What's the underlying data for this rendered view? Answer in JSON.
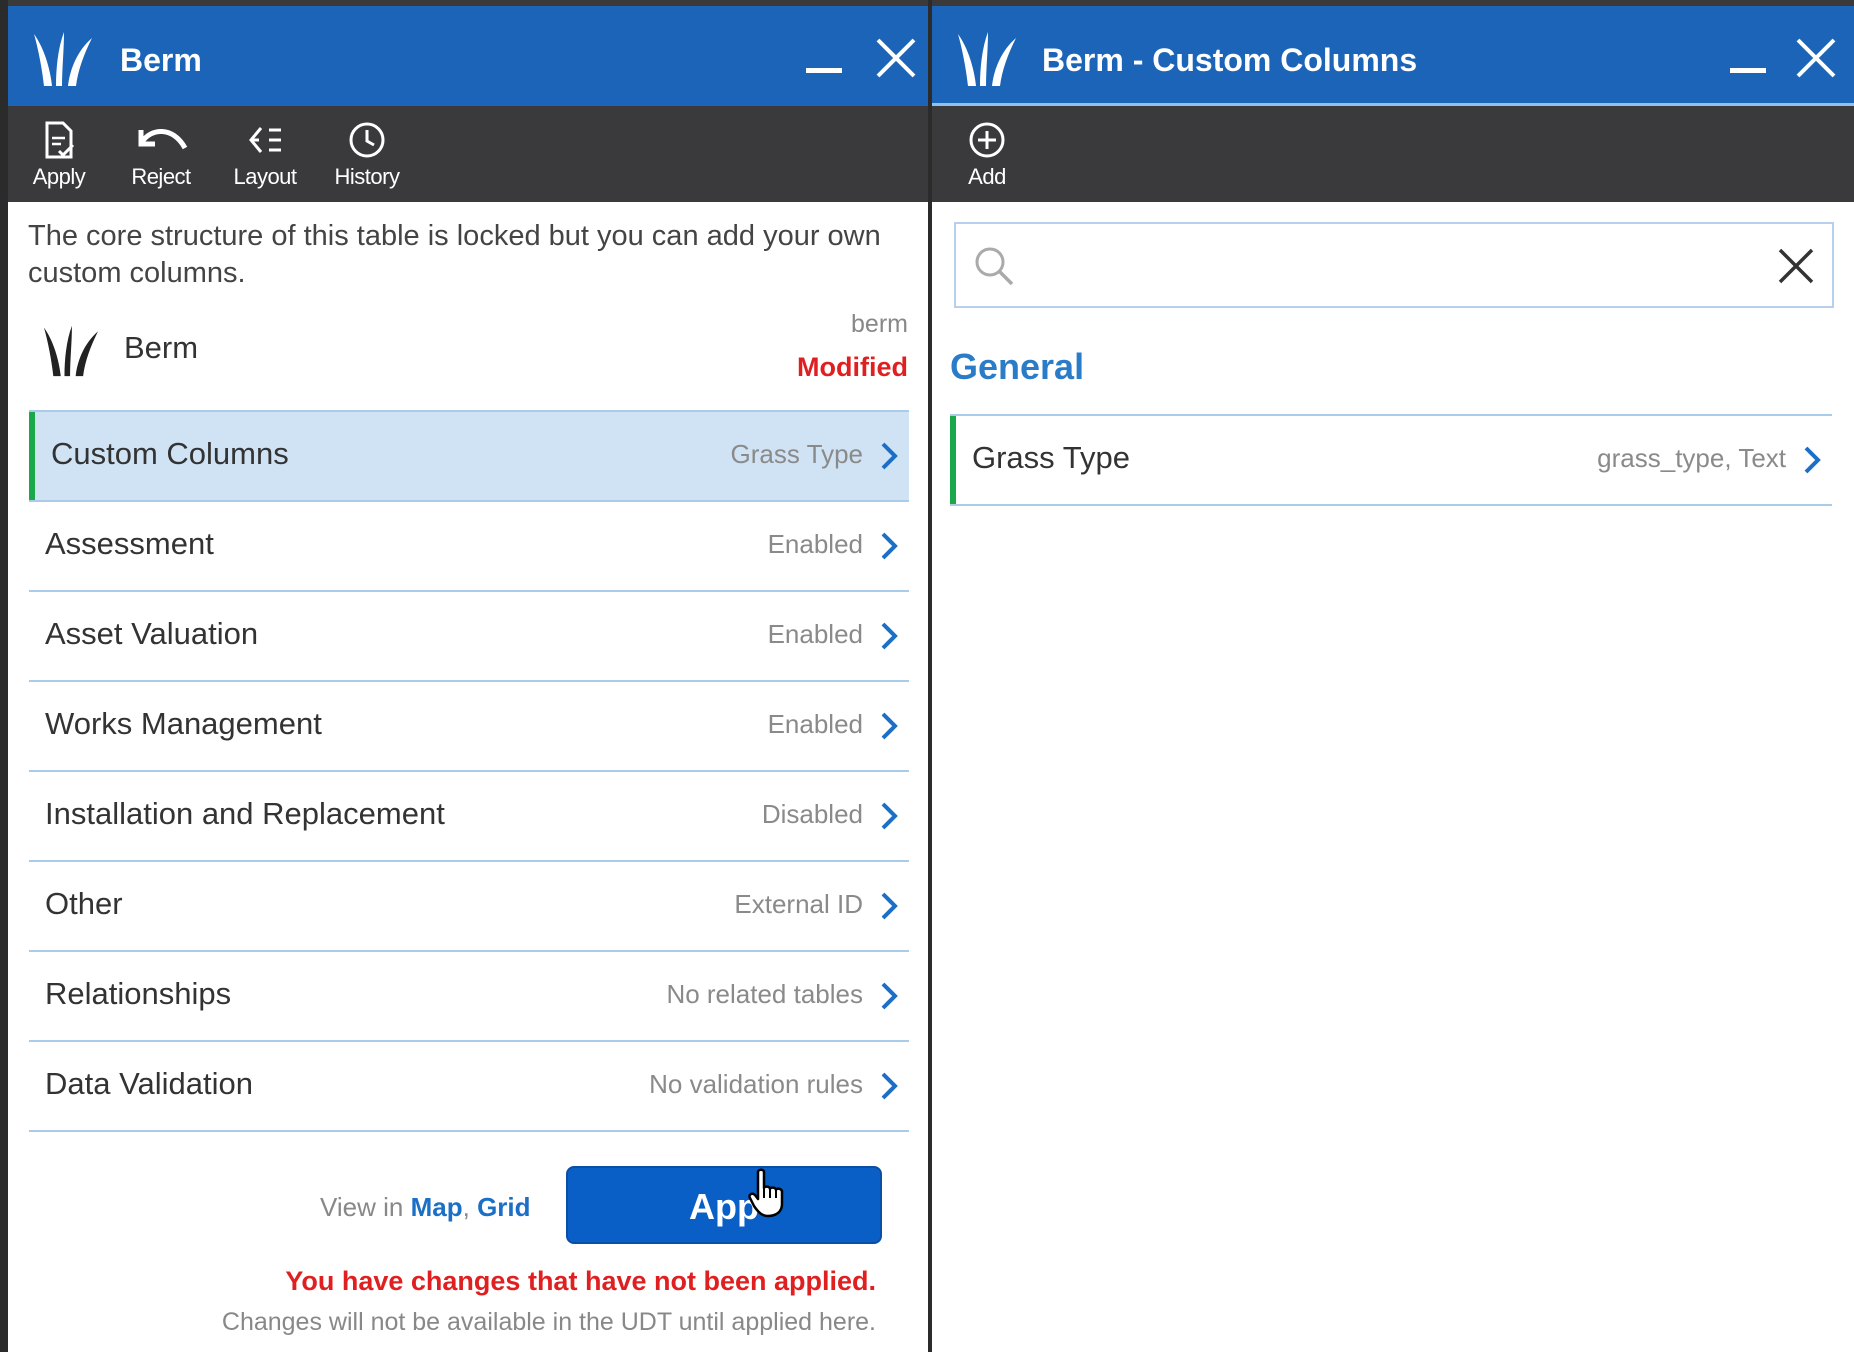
{
  "left_window": {
    "title": "Berm",
    "toolbar": [
      {
        "label": "Apply",
        "icon": "document-check-icon"
      },
      {
        "label": "Reject",
        "icon": "undo-icon"
      },
      {
        "label": "Layout",
        "icon": "layout-icon"
      },
      {
        "label": "History",
        "icon": "clock-icon"
      }
    ],
    "intro": "The core structure of this table is locked but you can add your own custom columns.",
    "table": {
      "name": "Berm",
      "code": "berm",
      "status": "Modified"
    },
    "rows": [
      {
        "label": "Custom Columns",
        "value": "Grass Type",
        "selected": true
      },
      {
        "label": "Assessment",
        "value": "Enabled"
      },
      {
        "label": "Asset Valuation",
        "value": "Enabled"
      },
      {
        "label": "Works Management",
        "value": "Enabled"
      },
      {
        "label": "Installation and Replacement",
        "value": "Disabled"
      },
      {
        "label": "Other",
        "value": "External ID"
      },
      {
        "label": "Relationships",
        "value": "No related tables"
      },
      {
        "label": "Data Validation",
        "value": "No validation rules"
      }
    ],
    "footer": {
      "view_in": "View in",
      "map_link": "Map",
      "separator": ",",
      "grid_link": "Grid",
      "apply_button": "App",
      "warning": "You have changes that have not been applied.",
      "note": "Changes will not be available in the UDT until applied here."
    }
  },
  "right_window": {
    "title": "Berm - Custom Columns",
    "toolbar": [
      {
        "label": "Add",
        "icon": "plus-circle-icon"
      }
    ],
    "search": {
      "value": "",
      "placeholder": ""
    },
    "section": "General",
    "rows": [
      {
        "label": "Grass Type",
        "value": "grass_type, Text",
        "selected": true
      }
    ]
  },
  "colors": {
    "titlebar": "#1c64b8",
    "toolbar": "#3a3a3c",
    "selected_row": "#d0e3f5",
    "accent_bar": "#1aa84a",
    "link": "#1c6fc6",
    "warning": "#e02020",
    "apply_button": "#0a5fc7"
  }
}
